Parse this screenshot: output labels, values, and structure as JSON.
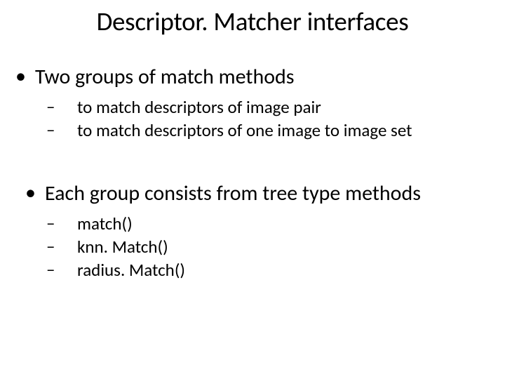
{
  "title": "Descriptor. Matcher interfaces",
  "groups": [
    {
      "level1": "Two groups of match methods",
      "items": [
        "to match descriptors of image pair",
        "to match descriptors of one image to image set"
      ]
    },
    {
      "level1": "Each group consists from tree type methods",
      "items": [
        "match()",
        "knn. Match()",
        "radius. Match()"
      ]
    }
  ],
  "markers": {
    "level1": "•",
    "level2": "–"
  }
}
